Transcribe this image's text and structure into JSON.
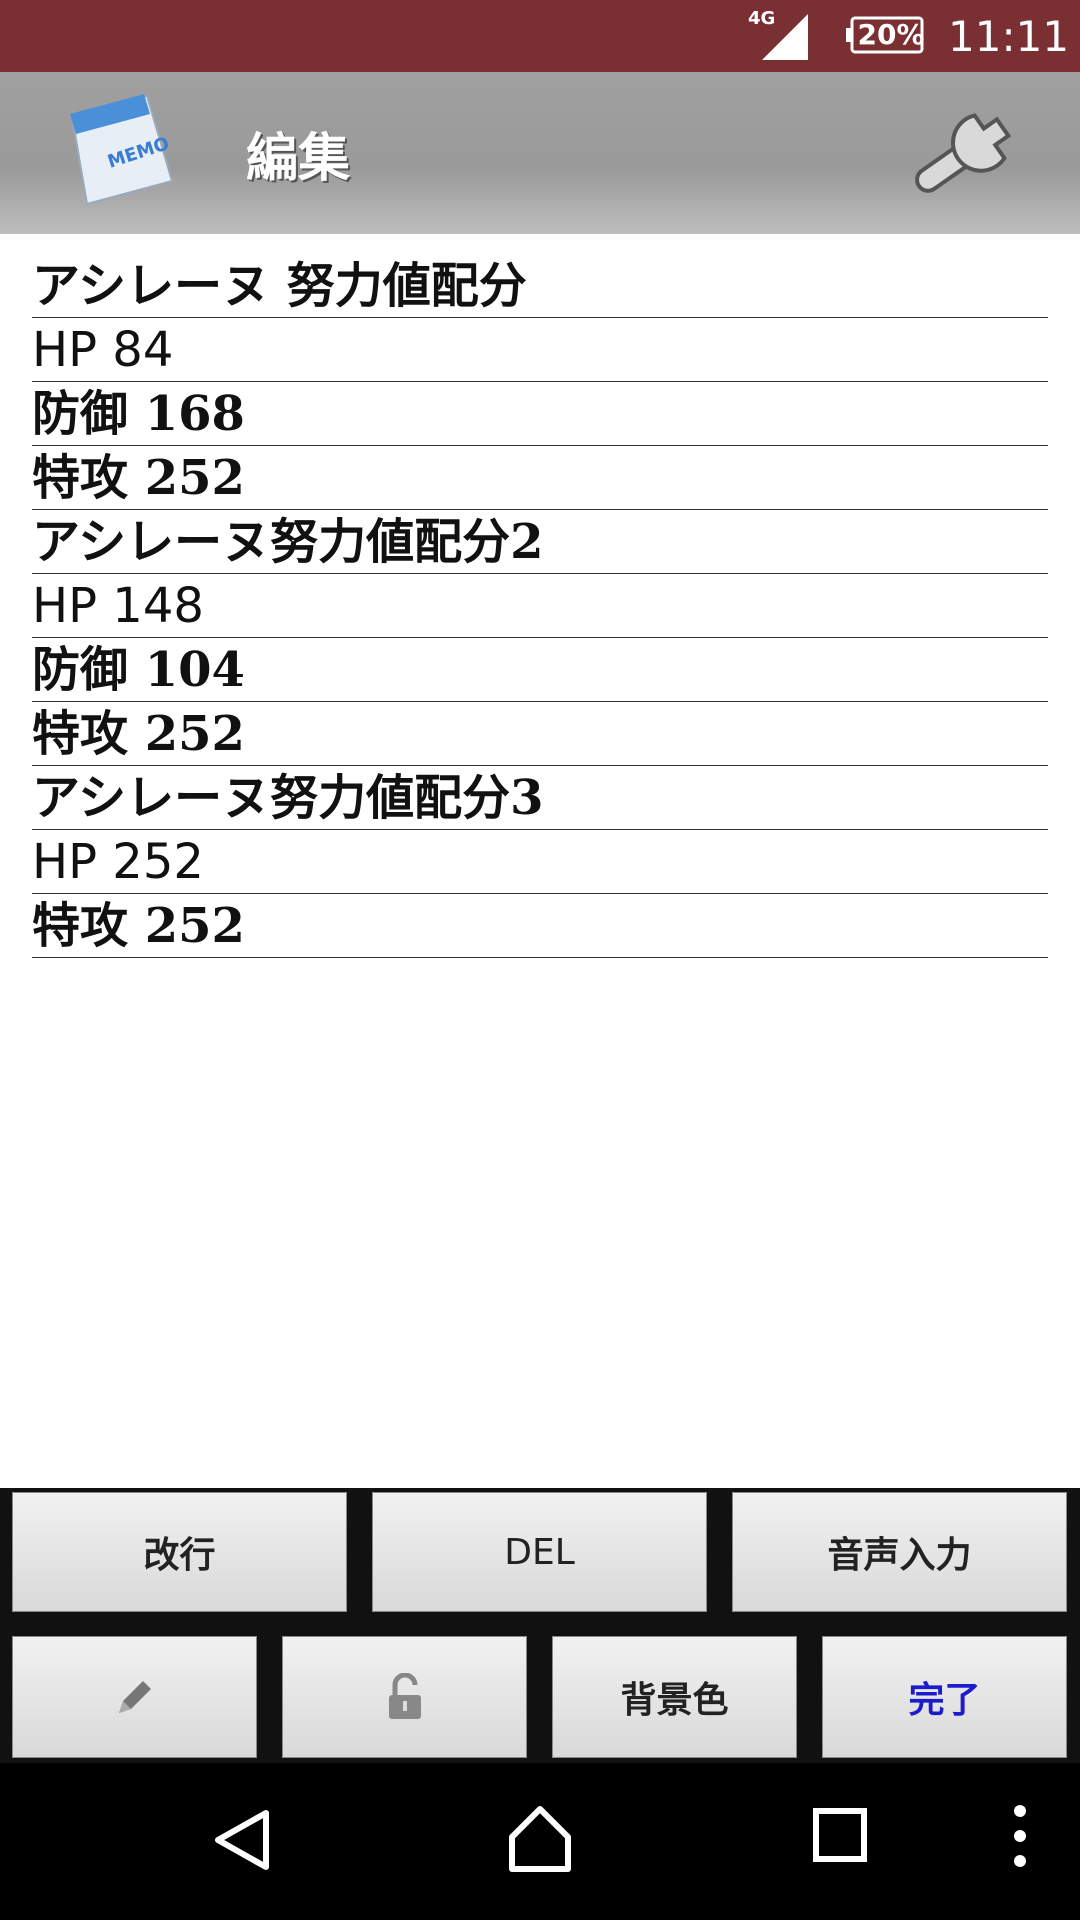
{
  "status_bar": {
    "network": "4G",
    "battery": "20%",
    "time": "11:11"
  },
  "app_bar": {
    "title": "編集",
    "app_icon": "memo-pad-icon",
    "settings_icon": "wrench-icon"
  },
  "note": {
    "lines": [
      "アシレーヌ 努力値配分",
      "HP  84",
      "防御  168",
      "特攻  252",
      "アシレーヌ努力値配分2",
      "HP  148",
      "防御  104",
      "特攻  252",
      "アシレーヌ努力値配分3",
      "HP   252",
      "特攻 252"
    ]
  },
  "buttons": {
    "newline": "改行",
    "delete": "DEL",
    "voice_input": "音声入力",
    "pen_icon": "pencil-icon",
    "lock_icon": "unlock-icon",
    "background_color": "背景色",
    "done": "完了"
  },
  "nav": {
    "back": "back-icon",
    "home": "home-icon",
    "recents": "recents-icon",
    "menu": "overflow-menu-icon"
  },
  "colors": {
    "status_bar": "#7a2f33",
    "done_text": "#1c1ccc"
  }
}
